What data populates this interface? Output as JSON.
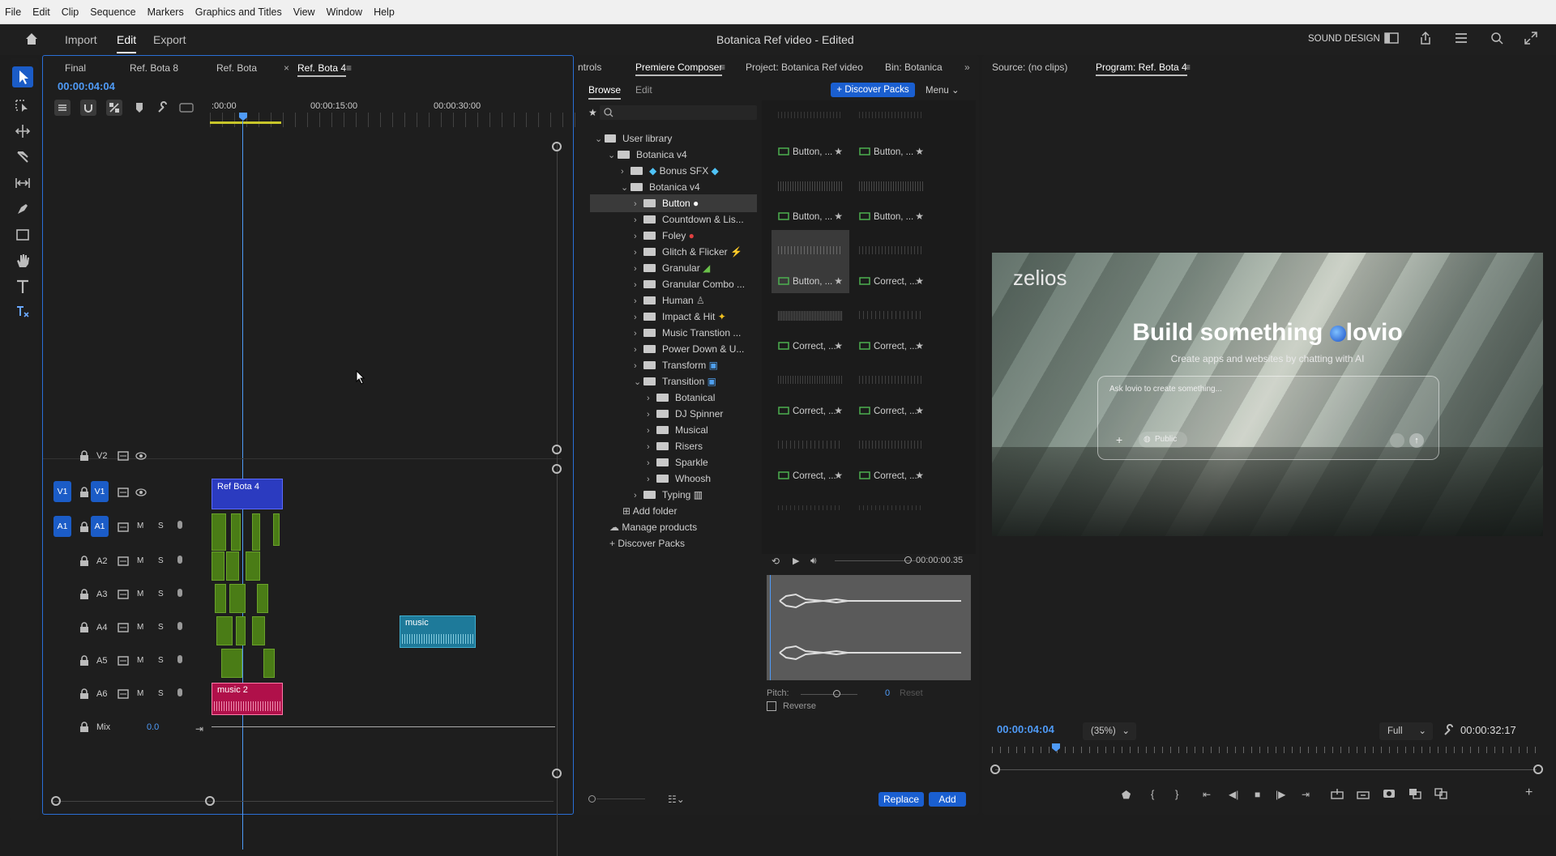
{
  "menu": [
    "File",
    "Edit",
    "Clip",
    "Sequence",
    "Markers",
    "Graphics and Titles",
    "View",
    "Window",
    "Help"
  ],
  "header": {
    "tabs": [
      "Import",
      "Edit",
      "Export"
    ],
    "title": "Botanica Ref video - Edited",
    "workspace": "SOUND DESIGN"
  },
  "timeline": {
    "tabs": [
      "Final",
      "Ref. Bota 8",
      "Ref. Bota",
      "Ref. Bota 4"
    ],
    "timecode": "00:00:04:04",
    "ruler": [
      ":00:00",
      "00:00:15:00",
      "00:00:30:00"
    ],
    "tracks": [
      {
        "name": "V2",
        "type": "video"
      },
      {
        "name": "V1",
        "type": "video"
      },
      {
        "name": "A1",
        "type": "audio"
      },
      {
        "name": "A2",
        "type": "audio"
      },
      {
        "name": "A3",
        "type": "audio"
      },
      {
        "name": "A4",
        "type": "audio"
      },
      {
        "name": "A5",
        "type": "audio"
      },
      {
        "name": "A6",
        "type": "audio"
      }
    ],
    "source_patch_v": "V1",
    "source_patch_a": "A1",
    "mix_label": "Mix",
    "mix_value": "0.0",
    "m_label": "M",
    "s_label": "S",
    "clips": {
      "v1": "Ref Bota 4",
      "a4": "music",
      "a6": "music 2"
    }
  },
  "composer": {
    "tabs": [
      "ntrols",
      "Premiere Composer",
      "Project: Botanica Ref video",
      "Bin: Botanica"
    ],
    "subtabs": [
      "Browse",
      "Edit"
    ],
    "discover_button": "+ Discover Packs",
    "menu_label": "Menu",
    "tree": [
      "User library",
      "Botanica v4",
      "Bonus SFX",
      "Botanica v4",
      "Button",
      "Countdown & Lis...",
      "Foley",
      "Glitch & Flicker",
      "Granular",
      "Granular Combo ...",
      "Human",
      "Impact & Hit",
      "Music Transtion ...",
      "Power Down & U...",
      "Transform",
      "Transition",
      "Botanical",
      "DJ Spinner",
      "Musical",
      "Risers",
      "Sparkle",
      "Whoosh",
      "Typing"
    ],
    "add_folder": "Add folder",
    "manage_products": "Manage products",
    "discover_packs": "Discover Packs",
    "presets": [
      "Button, ...",
      "Button, ...",
      "Button, ...",
      "Button, ...",
      "Button, ...",
      "Correct, ...",
      "Correct, ...",
      "Correct, ...",
      "Correct, ...",
      "Correct, ...",
      "Correct, ...",
      "Correct, ..."
    ],
    "preview_time": "00:00:00.35",
    "pitch_label": "Pitch:",
    "pitch_value": "0",
    "reset_label": "Reset",
    "reverse_label": "Reverse",
    "replace_button": "Replace",
    "add_button": "Add"
  },
  "program": {
    "source_tab": "Source: (no clips)",
    "program_tab": "Program: Ref. Bota 4",
    "timecode": "00:00:04:04",
    "zoom": "(35%)",
    "quality": "Full",
    "duration": "00:00:32:17",
    "video": {
      "brand": "zelios",
      "headline_a": "Build something",
      "headline_b": "lovio",
      "subline": "Create apps and websites by chatting with AI",
      "input_placeholder": "Ask lovio to create something...",
      "public_label": "Public"
    }
  }
}
